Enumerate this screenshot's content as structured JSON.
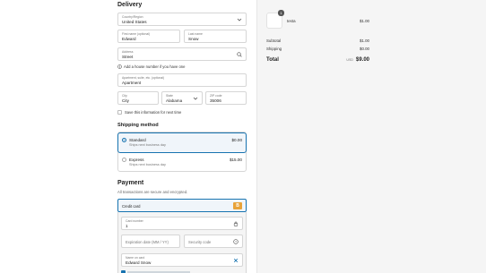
{
  "delivery": {
    "title": "Delivery",
    "country_label": "Country/Region",
    "country_value": "United States",
    "first_name_label": "First name (optional)",
    "first_name_value": "Edward",
    "last_name_label": "Last name",
    "last_name_value": "Snow",
    "address_label": "Address",
    "address_value": "Street",
    "house_note": "Add a house number if you have one",
    "apartment_label": "Apartment, suite, etc. (optional)",
    "apartment_value": "Apartment",
    "city_label": "City",
    "city_value": "City",
    "state_label": "State",
    "state_value": "Alabama",
    "zip_label": "ZIP code",
    "zip_value": "35006",
    "save_info": "Save this information for next time"
  },
  "shipping": {
    "title": "Shipping method",
    "options": [
      {
        "name": "Standard",
        "sub": "Ships next business day",
        "price": "$0.00",
        "selected": true
      },
      {
        "name": "Express",
        "sub": "Ships next business day",
        "price": "$15.00",
        "selected": false
      }
    ]
  },
  "payment": {
    "title": "Payment",
    "subtitle": "All transactions are secure and encrypted.",
    "method_label": "Credit card",
    "card_number_label": "Card number",
    "card_number_value": "1",
    "expiration_placeholder": "Expiration date (MM / YY)",
    "security_placeholder": "Security code",
    "name_label": "Name on card",
    "name_value": "Edward Snow"
  },
  "summary": {
    "item_qty": "1",
    "item_name": "testa",
    "item_price": "$1.00",
    "subtotal_label": "Subtotal",
    "subtotal_value": "$1.00",
    "shipping_label": "Shipping",
    "shipping_value": "$0.00",
    "total_label": "Total",
    "currency": "USD",
    "total_value": "$9.00"
  },
  "colors": {
    "accent": "#1773b0",
    "badge": "#e8a33a",
    "selected_bg": "#f0f5fa"
  }
}
